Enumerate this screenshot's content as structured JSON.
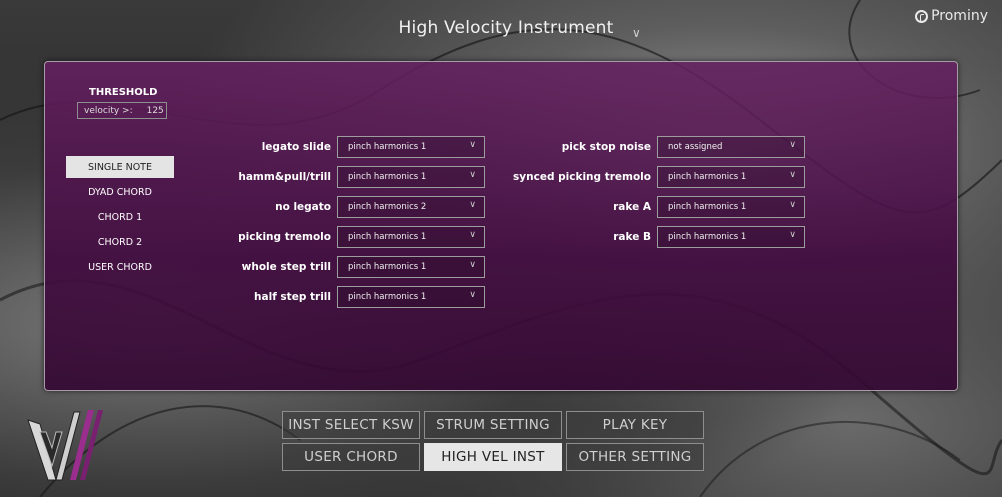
{
  "header": {
    "title": "High Velocity Instrument",
    "brand": "Prominy"
  },
  "threshold": {
    "label": "THRESHOLD",
    "velocity_label": "velocity >:",
    "velocity_value": "125"
  },
  "modes": [
    {
      "label": "SINGLE NOTE",
      "active": true
    },
    {
      "label": "DYAD CHORD",
      "active": false
    },
    {
      "label": "CHORD 1",
      "active": false
    },
    {
      "label": "CHORD 2",
      "active": false
    },
    {
      "label": "USER CHORD",
      "active": false
    }
  ],
  "left_assignments": [
    {
      "label": "legato slide",
      "value": "pinch harmonics 1"
    },
    {
      "label": "hamm&pull/trill",
      "value": "pinch harmonics 1"
    },
    {
      "label": "no legato",
      "value": "pinch harmonics 2"
    },
    {
      "label": "picking tremolo",
      "value": "pinch harmonics 1"
    },
    {
      "label": "whole step trill",
      "value": "pinch harmonics 1"
    },
    {
      "label": "half step trill",
      "value": "pinch harmonics 1"
    }
  ],
  "right_assignments": [
    {
      "label": "pick stop noise",
      "value": "not assigned"
    },
    {
      "label": "synced picking tremolo",
      "value": "pinch harmonics 1"
    },
    {
      "label": "rake A",
      "value": "pinch harmonics 1"
    },
    {
      "label": "rake B",
      "value": "pinch harmonics 1"
    }
  ],
  "tabs": {
    "row1": [
      "INST SELECT KSW",
      "STRUM SETTING",
      "PLAY KEY"
    ],
    "row2": [
      "USER CHORD",
      "HIGH VEL INST",
      "OTHER SETTING"
    ],
    "active": "HIGH VEL INST"
  },
  "colors": {
    "panel": "#4e0f4c",
    "active_bg": "#e4e4e4",
    "logo_accent": "#9b2d8e"
  }
}
